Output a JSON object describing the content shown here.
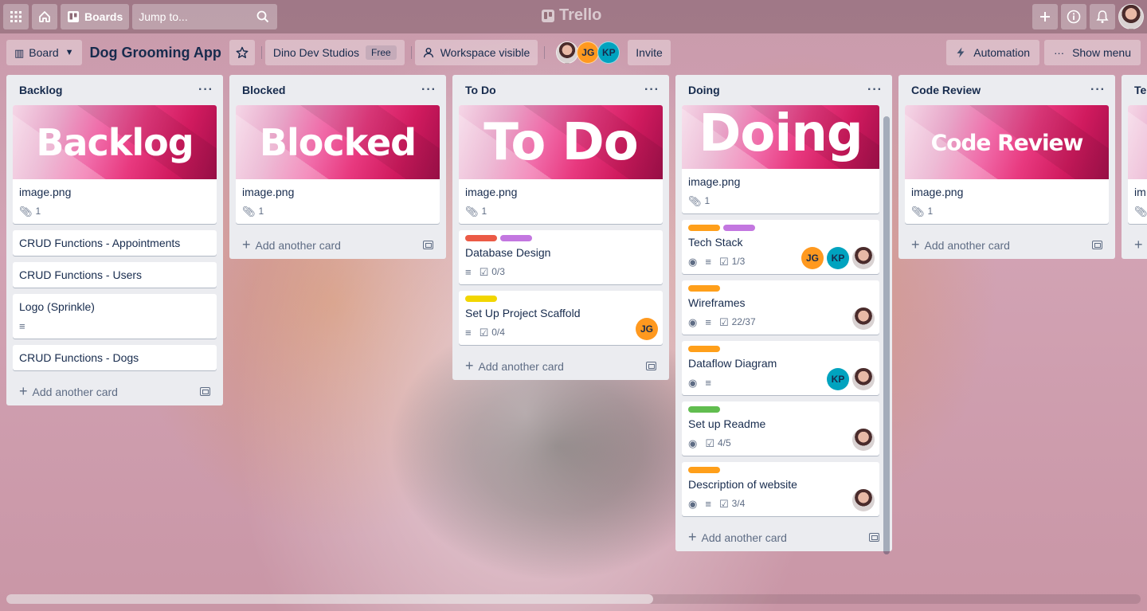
{
  "topbar": {
    "boards_label": "Boards",
    "search_placeholder": "Jump to...",
    "logo": "Trello"
  },
  "board": {
    "view_label": "Board",
    "title": "Dog Grooming App",
    "workspace": "Dino Dev Studios",
    "plan_badge": "Free",
    "visibility": "Workspace visible",
    "members": [
      "JG",
      "KP"
    ],
    "invite_label": "Invite",
    "automation_label": "Automation",
    "show_menu_label": "Show menu"
  },
  "colors": {
    "label_red": "#eb5a46",
    "label_purple": "#c377e0",
    "label_orange": "#ff9f1a",
    "label_yellow": "#f2d600",
    "label_green": "#61bd4f",
    "member_jg": "#ff991f",
    "member_kp": "#00a3bf"
  },
  "lists": [
    {
      "title": "Backlog",
      "cover_text": "Backlog",
      "cover_card": {
        "title": "image.png",
        "attachments": "1"
      },
      "cards": [
        {
          "title": "CRUD Functions - Appointments"
        },
        {
          "title": "CRUD Functions - Users"
        },
        {
          "title": "Logo (Sprinkle)"
        },
        {
          "title": "CRUD Functions - Dogs"
        }
      ],
      "add_label": "Add another card"
    },
    {
      "title": "Blocked",
      "cover_text": "Blocked",
      "cover_card": {
        "title": "image.png",
        "attachments": "1"
      },
      "add_label": "Add another card"
    },
    {
      "title": "To Do",
      "cover_text": "To Do",
      "cover_card": {
        "title": "image.png",
        "attachments": "1"
      },
      "cards": [
        {
          "title": "Database Design",
          "checklist": "0/3"
        },
        {
          "title": "Set Up Project Scaffold",
          "checklist": "0/4",
          "member": "JG"
        }
      ],
      "add_label": "Add another card"
    },
    {
      "title": "Doing",
      "cover_text": "Doing",
      "cover_card": {
        "title": "image.png",
        "attachments": "1"
      },
      "cards": [
        {
          "title": "Tech Stack",
          "checklist": "1/3",
          "members": [
            "JG",
            "KP"
          ]
        },
        {
          "title": "Wireframes",
          "checklist": "22/37"
        },
        {
          "title": "Dataflow Diagram",
          "members": [
            "KP"
          ]
        },
        {
          "title": "Set up Readme",
          "checklist": "4/5"
        },
        {
          "title": "Description of website",
          "checklist": "3/4"
        }
      ],
      "add_label": "Add another card"
    },
    {
      "title": "Code Review",
      "cover_text": "Code Review",
      "cover_card": {
        "title": "image.png",
        "attachments": "1"
      },
      "add_label": "Add another card"
    },
    {
      "title": "Te",
      "cover_card": {
        "title": "im"
      }
    }
  ]
}
